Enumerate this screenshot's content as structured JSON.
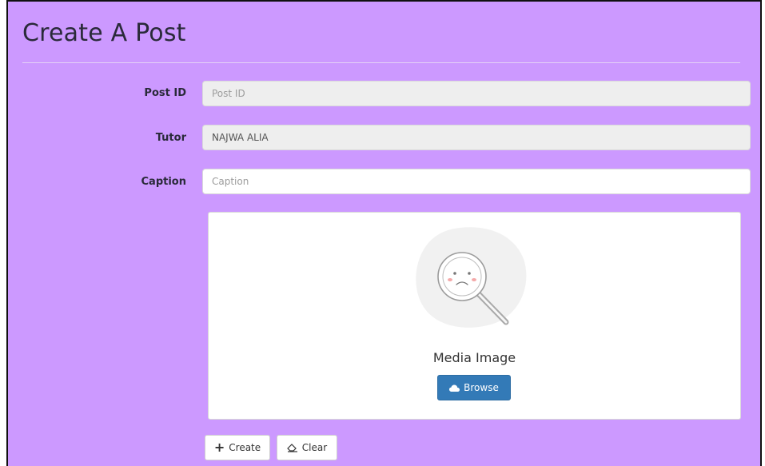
{
  "page": {
    "title": "Create A Post"
  },
  "form": {
    "post_id": {
      "label": "Post ID",
      "value": "",
      "placeholder": "Post ID"
    },
    "tutor": {
      "label": "Tutor",
      "value": "NAJWA ALIA",
      "placeholder": ""
    },
    "caption": {
      "label": "Caption",
      "value": "",
      "placeholder": "Caption"
    }
  },
  "media": {
    "label": "Media Image",
    "browse_label": "Browse",
    "illustration": "no-image-magnifier-icon"
  },
  "actions": {
    "create_label": "Create",
    "clear_label": "Clear",
    "create_icon": "plus-icon",
    "clear_icon": "eraser-icon"
  },
  "colors": {
    "panel_bg": "#cc99ff",
    "primary_button": "#337ab7"
  }
}
